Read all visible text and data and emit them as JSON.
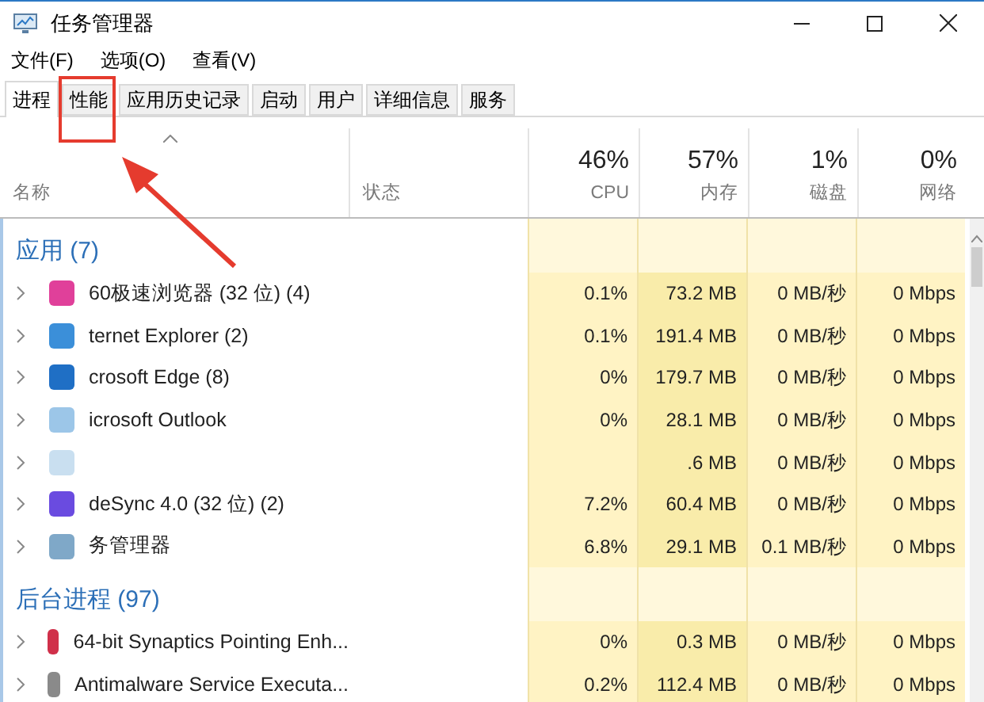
{
  "window": {
    "title": "任务管理器"
  },
  "menu": [
    "文件(F)",
    "选项(O)",
    "查看(V)"
  ],
  "tabs": [
    {
      "label": "进程",
      "selected": true
    },
    {
      "label": "性能",
      "selected": false
    },
    {
      "label": "应用历史记录",
      "selected": false
    },
    {
      "label": "启动",
      "selected": false
    },
    {
      "label": "用户",
      "selected": false
    },
    {
      "label": "详细信息",
      "selected": false
    },
    {
      "label": "服务",
      "selected": false
    }
  ],
  "columns": [
    {
      "label": "名称",
      "kind": "name"
    },
    {
      "label": "状态",
      "kind": "status"
    },
    {
      "usage": "46%",
      "label": "CPU",
      "kind": "metric"
    },
    {
      "usage": "57%",
      "label": "内存",
      "kind": "metric"
    },
    {
      "usage": "1%",
      "label": "磁盘",
      "kind": "metric"
    },
    {
      "usage": "0%",
      "label": "网络",
      "kind": "metric"
    }
  ],
  "groups": [
    {
      "label": "应用 (7)",
      "rows": [
        {
          "name": "60极速浏览器 (32 位) (4)",
          "cells": [
            "0.1%",
            "73.2 MB",
            "0 MB/秒",
            "0 Mbps"
          ]
        },
        {
          "name": "ternet Explorer (2)",
          "cells": [
            "0.1%",
            "191.4 MB",
            "0 MB/秒",
            "0 Mbps"
          ]
        },
        {
          "name": "crosoft Edge (8)",
          "cells": [
            "0%",
            "179.7 MB",
            "0 MB/秒",
            "0 Mbps"
          ]
        },
        {
          "name": "icrosoft Outlook",
          "cells": [
            "0%",
            "28.1 MB",
            "0 MB/秒",
            "0 Mbps"
          ]
        },
        {
          "cells": [
            null,
            ".6 MB",
            "0 MB/秒",
            "0 Mbps"
          ]
        },
        {
          "name": "deSync 4.0 (32 位) (2)",
          "cells": [
            "7.2%",
            "60.4 MB",
            "0 MB/秒",
            "0 Mbps"
          ]
        },
        {
          "name": "务管理器",
          "cells": [
            "6.8%",
            "29.1 MB",
            "0.1 MB/秒",
            "0 Mbps"
          ]
        }
      ]
    },
    {
      "label": "后台进程 (97)",
      "rows": [
        {
          "name": "64-bit Synaptics Pointing Enh...",
          "cells": [
            "0%",
            "0.3 MB",
            "0 MB/秒",
            "0 Mbps"
          ]
        },
        {
          "name": "Antimalware Service Executa...",
          "cells": [
            "0.2%",
            "112.4 MB",
            "0 MB/秒",
            "0 Mbps"
          ]
        }
      ]
    }
  ]
}
